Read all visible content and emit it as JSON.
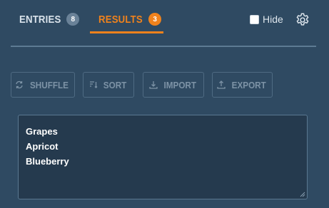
{
  "tabs": [
    {
      "label": "ENTRIES",
      "count": "8"
    },
    {
      "label": "RESULTS",
      "count": "3"
    }
  ],
  "active_tab": "RESULTS",
  "hide_toggle": {
    "label": "Hide",
    "checked": false
  },
  "toolbar": {
    "shuffle": "SHUFFLE",
    "sort": "SORT",
    "import": "IMPORT",
    "export": "EXPORT"
  },
  "results": [
    "Grapes",
    "Apricot",
    "Blueberry"
  ],
  "colors": {
    "background": "#2f4a62",
    "accent": "#f0821c",
    "badge_inactive": "#6a8298",
    "button_text": "#7d93a6",
    "textarea_bg": "#253a4e"
  },
  "icons": {
    "shuffle": "refresh-icon",
    "sort": "sort-icon",
    "import": "download-icon",
    "export": "upload-icon",
    "settings": "gear-icon"
  }
}
